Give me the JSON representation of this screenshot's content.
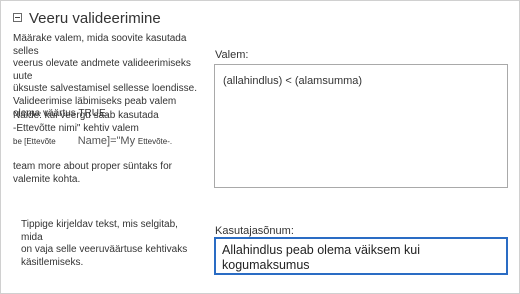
{
  "section": {
    "title": "Veeru valideerimine",
    "icon": "collapse-minus-icon"
  },
  "description": {
    "paragraph1": [
      "Määrake valem, mida soovite kasutada selles",
      "veerus olevate andmete valideerimiseks uute",
      "üksuste salvestamisel sellesse loendisse.",
      "Valideerimise läbimiseks peab valem",
      "olema väärtus TRUE."
    ],
    "example_line1": "Näide: kui veergu saab kasutada",
    "example_line2": "-Ettevõtte nimi\" kehtiv valem",
    "example_line3_prefix": "be [Ettevõte",
    "example_line3_formula": "Name]=\"My",
    "example_line3_suffix": "Ettevõte-.",
    "learn_more": [
      "team more about proper süntaks for",
      "valemite kohta."
    ],
    "message_hint": [
      "Tippige kirjeldav tekst, mis selgitab, mida",
      "on vaja selle veeruväärtuse kehtivaks",
      "käsitlemiseks."
    ]
  },
  "fields": {
    "formula_label": "Valem:",
    "formula_value": "(allahindlus) < (alamsumma)",
    "message_label": "Kasutajasõnum:",
    "message_value": "Allahindlus peab olema väiksem kui kogumaksumus"
  },
  "colors": {
    "border": "#d0d0d0",
    "active_input_border": "#2a6cc4"
  }
}
